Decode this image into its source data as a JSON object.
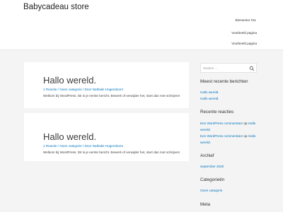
{
  "header": {
    "site_title": "Babycadeau store",
    "nav": [
      {
        "label": "Elementor #11"
      },
      {
        "label": "Voorbeeld pagina"
      },
      {
        "label": "Voorbeeld pagina"
      }
    ]
  },
  "posts": [
    {
      "title": "Hallo wereld.",
      "meta": "1 Reactie / Geen categorie / Door Nathalie Hogendoorn",
      "excerpt": "Welkom bij WordPress. Dit is je eerste bericht. Bewerk of verwijder het, start dan met schrijven!"
    },
    {
      "title": "Hallo wereld.",
      "meta": "1 Reactie / Geen categorie / Door Nathalie Hogendoorn",
      "excerpt": "Welkom bij WordPress. Dit is je eerste bericht. Bewerk of verwijder het, start dan met schrijven!"
    }
  ],
  "sidebar": {
    "search": {
      "placeholder": "Zoeken ..."
    },
    "recent_posts": {
      "title": "Meest recente berichten",
      "items": [
        "Hallo wereld.",
        "Hallo wereld."
      ]
    },
    "recent_comments": {
      "title": "Recente reacties",
      "items": [
        {
          "author": "Een WordPress commentator",
          "sep": " op ",
          "post_a": "Hallo",
          "post_b": "wereld."
        },
        {
          "author": "Een WordPress commentator",
          "sep": " op ",
          "post_a": "Hallo",
          "post_b": "wereld."
        }
      ]
    },
    "archive": {
      "title": "Archief",
      "items": [
        "september 2020"
      ]
    },
    "categories": {
      "title": "Categorieën",
      "items": [
        "Geen categorie"
      ]
    },
    "meta": {
      "title": "Meta"
    }
  },
  "colors": {
    "link": "#0274be",
    "background": "#f4f4f4"
  }
}
